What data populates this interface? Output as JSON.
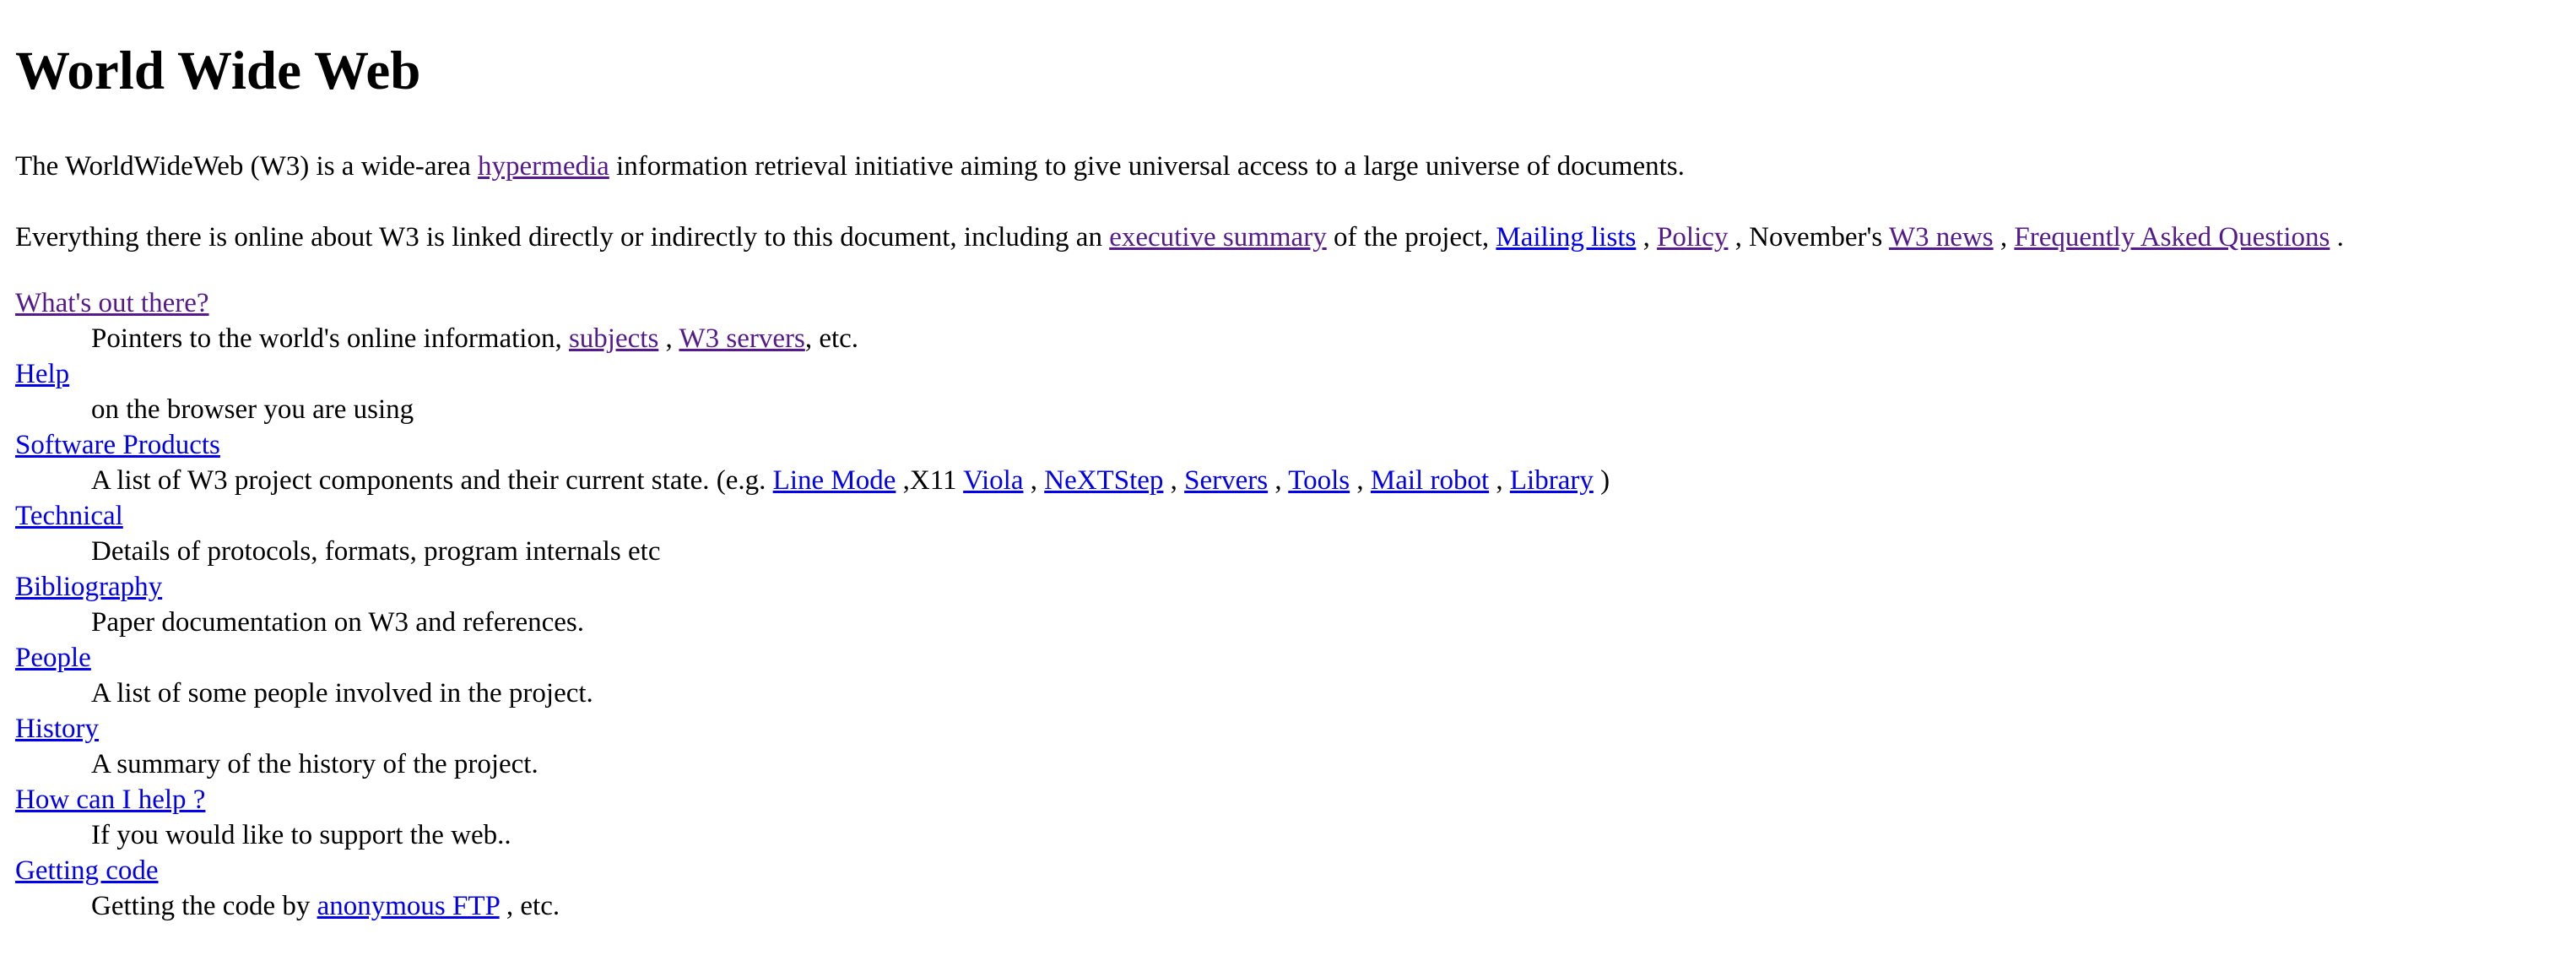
{
  "page_title": "World Wide Web",
  "colors": {
    "link_unvisited": "#0000ee",
    "link_visited": "#551a8b",
    "text": "#000000",
    "background": "#ffffff"
  },
  "intro": {
    "before": "The WorldWideWeb (W3) is a wide-area ",
    "link": "hypermedia",
    "after": " information retrieval initiative aiming to give universal access to a large universe of documents."
  },
  "everything": {
    "before": "Everything there is online about W3 is linked directly or indirectly to this document, including an ",
    "link_executive_summary": "executive summary",
    "mid1": " of the project, ",
    "link_mailing_lists": "Mailing lists",
    "sep1": " , ",
    "link_policy": "Policy",
    "mid2": " , November's ",
    "link_w3_news": "W3 news",
    "sep2": " , ",
    "link_faq": "Frequently Asked Questions",
    "end": " ."
  },
  "sections": {
    "whats_out_there": {
      "term": "What's out there?",
      "desc_before": "Pointers to the world's online information, ",
      "link_subjects": "subjects",
      "sep": " , ",
      "link_w3_servers": "W3 servers",
      "desc_after": ", etc."
    },
    "help": {
      "term": "Help",
      "desc": "on the browser you are using"
    },
    "software_products": {
      "term": "Software Products",
      "desc_before": "A list of W3 project components and their current state. (e.g. ",
      "link_line_mode": "Line Mode",
      "x11": " ,X11 ",
      "link_viola": "Viola",
      "sep1": " , ",
      "link_nextstep": "NeXTStep",
      "sep2": " , ",
      "link_servers": "Servers",
      "sep3": " , ",
      "link_tools": "Tools",
      "sep4": " , ",
      "link_mail_robot": "Mail robot",
      "sep5": " , ",
      "link_library": "Library",
      "desc_after": " )"
    },
    "technical": {
      "term": "Technical",
      "desc": "Details of protocols, formats, program internals etc"
    },
    "bibliography": {
      "term": "Bibliography",
      "desc": "Paper documentation on W3 and references."
    },
    "people": {
      "term": "People",
      "desc": "A list of some people involved in the project."
    },
    "history": {
      "term": "History",
      "desc": "A summary of the history of the project."
    },
    "how_can_i_help": {
      "term": "How can I help ?",
      "desc": "If you would like to support the web.."
    },
    "getting_code": {
      "term": "Getting code",
      "desc_before": "Getting the code by ",
      "link_anonymous_ftp": "anonymous FTP",
      "desc_after": " , etc."
    }
  }
}
